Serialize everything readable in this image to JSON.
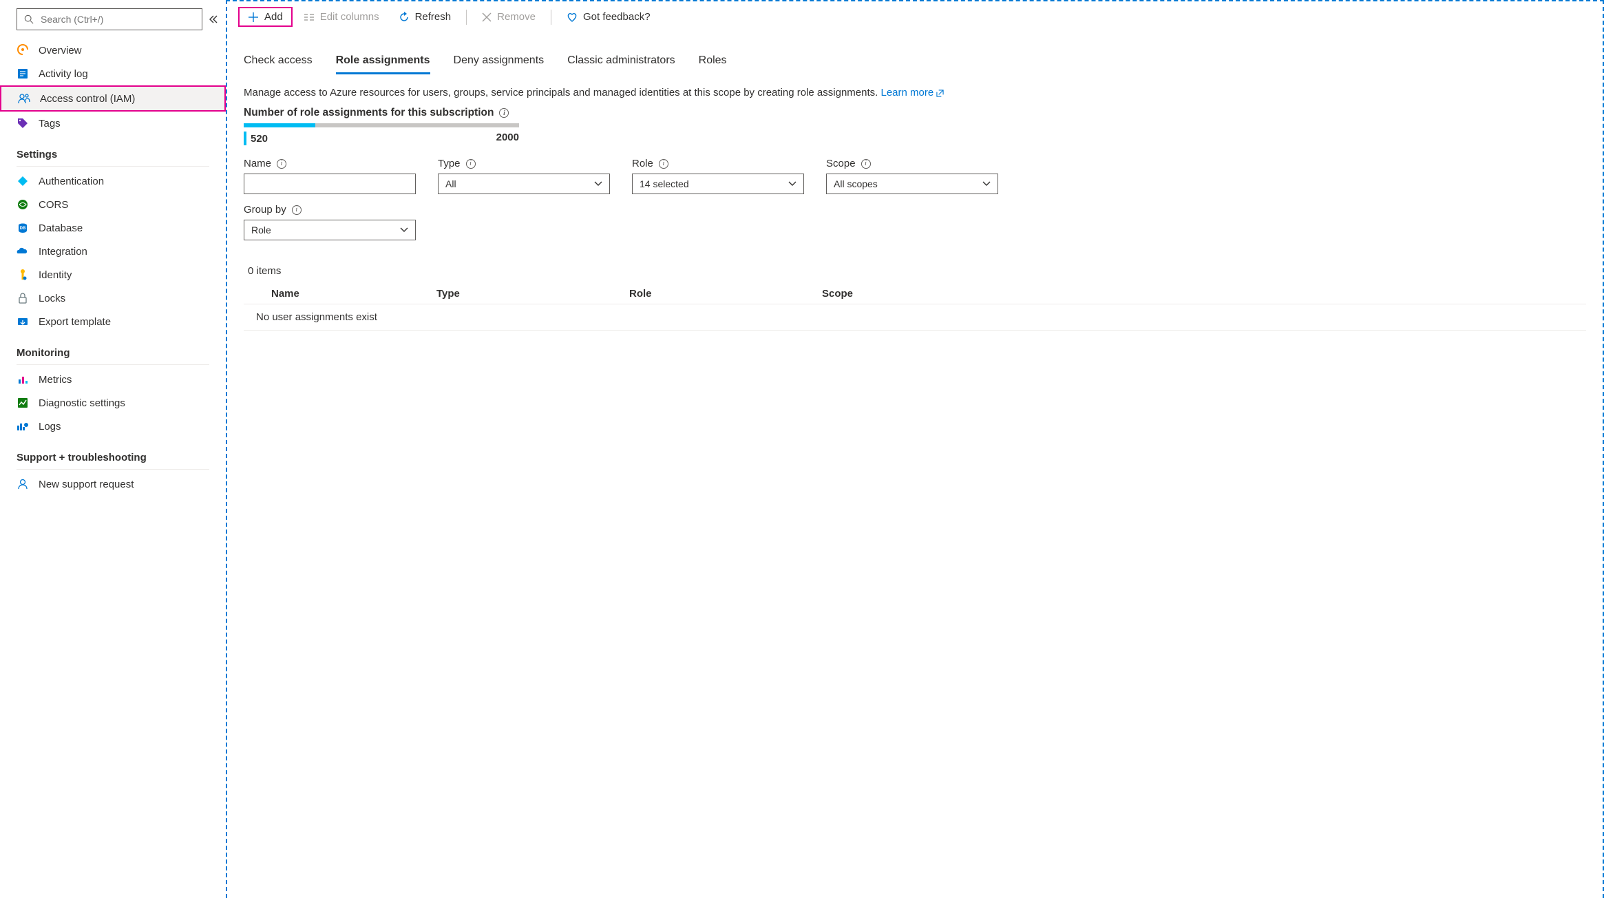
{
  "sidebar": {
    "search_placeholder": "Search (Ctrl+/)",
    "items": [
      {
        "label": "Overview"
      },
      {
        "label": "Activity log"
      },
      {
        "label": "Access control (IAM)"
      },
      {
        "label": "Tags"
      }
    ],
    "settings_header": "Settings",
    "settings_items": [
      {
        "label": "Authentication"
      },
      {
        "label": "CORS"
      },
      {
        "label": "Database"
      },
      {
        "label": "Integration"
      },
      {
        "label": "Identity"
      },
      {
        "label": "Locks"
      },
      {
        "label": "Export template"
      }
    ],
    "monitoring_header": "Monitoring",
    "monitoring_items": [
      {
        "label": "Metrics"
      },
      {
        "label": "Diagnostic settings"
      },
      {
        "label": "Logs"
      }
    ],
    "support_header": "Support + troubleshooting",
    "support_items": [
      {
        "label": "New support request"
      }
    ]
  },
  "toolbar": {
    "add": "Add",
    "edit_columns": "Edit columns",
    "refresh": "Refresh",
    "remove": "Remove",
    "feedback": "Got feedback?"
  },
  "tabs": {
    "check_access": "Check access",
    "role_assignments": "Role assignments",
    "deny_assignments": "Deny assignments",
    "classic_administrators": "Classic administrators",
    "roles": "Roles"
  },
  "body": {
    "description": "Manage access to Azure resources for users, groups, service principals and managed identities at this scope by creating role assignments.",
    "learn_more": "Learn more",
    "count_label": "Number of role assignments for this subscription",
    "count_current": "520",
    "count_max": "2000",
    "count_fill_percent": "26"
  },
  "filters": {
    "name_label": "Name",
    "type_label": "Type",
    "type_value": "All",
    "role_label": "Role",
    "role_value": "14 selected",
    "scope_label": "Scope",
    "scope_value": "All scopes",
    "groupby_label": "Group by",
    "groupby_value": "Role"
  },
  "table": {
    "items_count": "0 items",
    "col_name": "Name",
    "col_type": "Type",
    "col_role": "Role",
    "col_scope": "Scope",
    "empty": "No user assignments exist"
  }
}
